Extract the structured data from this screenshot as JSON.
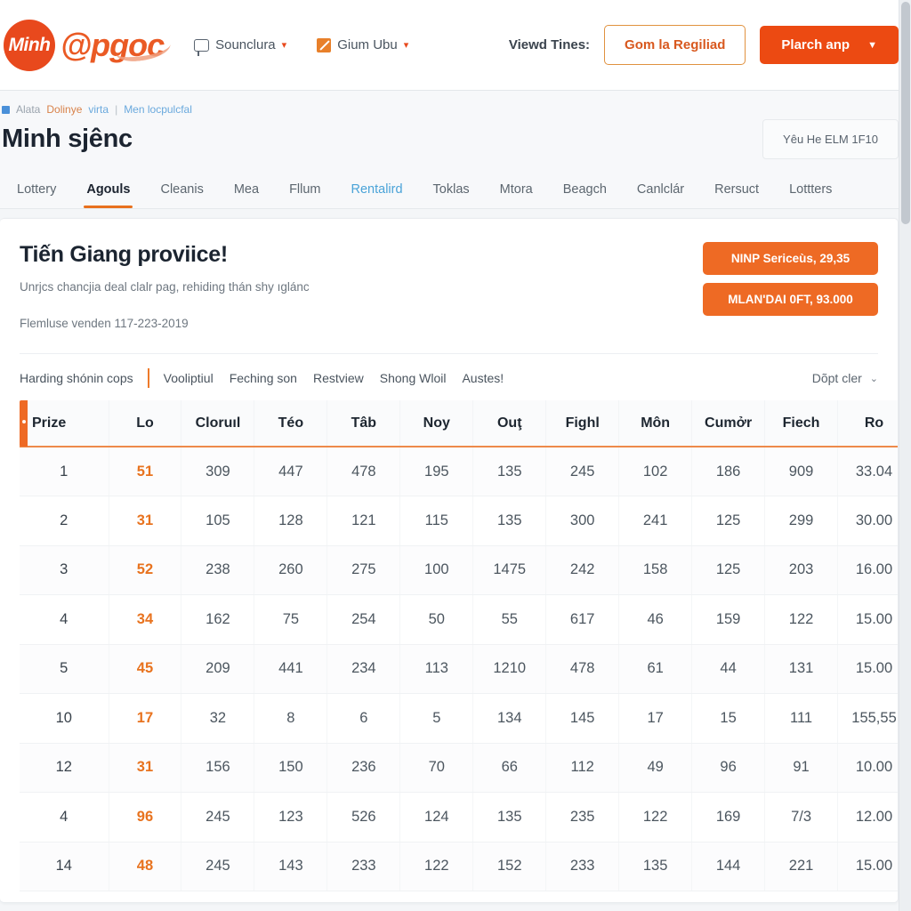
{
  "header": {
    "brand_badge": "Minh",
    "brand_word": "pgoc",
    "nav": [
      {
        "label": "Sounclura",
        "icon": "chat-icon",
        "caret": "▾"
      },
      {
        "label": "Gium Ubu",
        "icon": "note-icon",
        "caret": "▾"
      }
    ],
    "viewd_label": "Viewd Tines:",
    "outline_button": "Gom la Regiliad",
    "solid_button": "Plarch anp",
    "solid_caret": "▼"
  },
  "breadcrumb": {
    "icon": "page-icon",
    "part1": "Alata",
    "part2": "Dolinye",
    "part3": "virta",
    "separator": "|",
    "part4": "Men locpulcfal"
  },
  "page_title": "Minh sjênc",
  "title_chip": "Yêu He ELM 1F10",
  "tabs": [
    {
      "label": "Lottery",
      "state": "normal"
    },
    {
      "label": "Agouls",
      "state": "active"
    },
    {
      "label": "Cleanis",
      "state": "normal"
    },
    {
      "label": "Mea",
      "state": "normal"
    },
    {
      "label": "Fllum",
      "state": "normal"
    },
    {
      "label": "Rentalird",
      "state": "link"
    },
    {
      "label": "Toklas",
      "state": "normal"
    },
    {
      "label": "Mtora",
      "state": "normal"
    },
    {
      "label": "Beagch",
      "state": "normal"
    },
    {
      "label": "Canlclár",
      "state": "normal"
    },
    {
      "label": "Rersuct",
      "state": "normal"
    },
    {
      "label": "Lottters",
      "state": "normal"
    }
  ],
  "promo": {
    "title": "Tiến Giang proviice!",
    "subtitle": "Unrjcs chancjia deal clalr pag, rehiding thán shy ıglánc",
    "meta": "Flemluse venden 117-223-2019",
    "pill_1": "NINP Sericeùs, 29,35",
    "pill_2": "MLAN'DAI 0FT, 93.000"
  },
  "filters": [
    "Harding shónin cops",
    "Vooliptiul",
    "Feching son",
    "Restview",
    "Shong Wloil",
    "Austes!"
  ],
  "sorter": {
    "label": "Dõpt cler",
    "caret": "⌄"
  },
  "chart_data": {
    "type": "table",
    "title": "Tiến Giang proviice!",
    "columns": [
      "Prize",
      "Lo",
      "Cloruıl",
      "Téo",
      "Tâb",
      "Noy",
      "Ouţ",
      "Fighl",
      "Môn",
      "Cumởr",
      "Fiech",
      "Ro"
    ],
    "rows": [
      [
        "1",
        "51",
        "309",
        "447",
        "478",
        "195",
        "135",
        "245",
        "102",
        "186",
        "909",
        "33.04"
      ],
      [
        "2",
        "31",
        "105",
        "128",
        "121",
        "115",
        "135",
        "300",
        "241",
        "125",
        "299",
        "30.00"
      ],
      [
        "3",
        "52",
        "238",
        "260",
        "275",
        "100",
        "1475",
        "242",
        "158",
        "125",
        "203",
        "16.00"
      ],
      [
        "4",
        "34",
        "162",
        "75",
        "254",
        "50",
        "55",
        "617",
        "46",
        "159",
        "122",
        "15.00"
      ],
      [
        "5",
        "45",
        "209",
        "441",
        "234",
        "113",
        "1210",
        "478",
        "61",
        "44",
        "131",
        "15.00"
      ],
      [
        "10",
        "17",
        "32",
        "8",
        "6",
        "5",
        "134",
        "145",
        "17",
        "15",
        "111",
        "155,55"
      ],
      [
        "12",
        "31",
        "156",
        "150",
        "236",
        "70",
        "66",
        "112",
        "49",
        "96",
        "91",
        "10.00"
      ],
      [
        "4",
        "96",
        "245",
        "123",
        "526",
        "124",
        "135",
        "235",
        "122",
        "169",
        "7/3",
        "12.00"
      ],
      [
        "14",
        "48",
        "245",
        "143",
        "233",
        "122",
        "152",
        "233",
        "135",
        "144",
        "221",
        "15.00"
      ]
    ]
  }
}
